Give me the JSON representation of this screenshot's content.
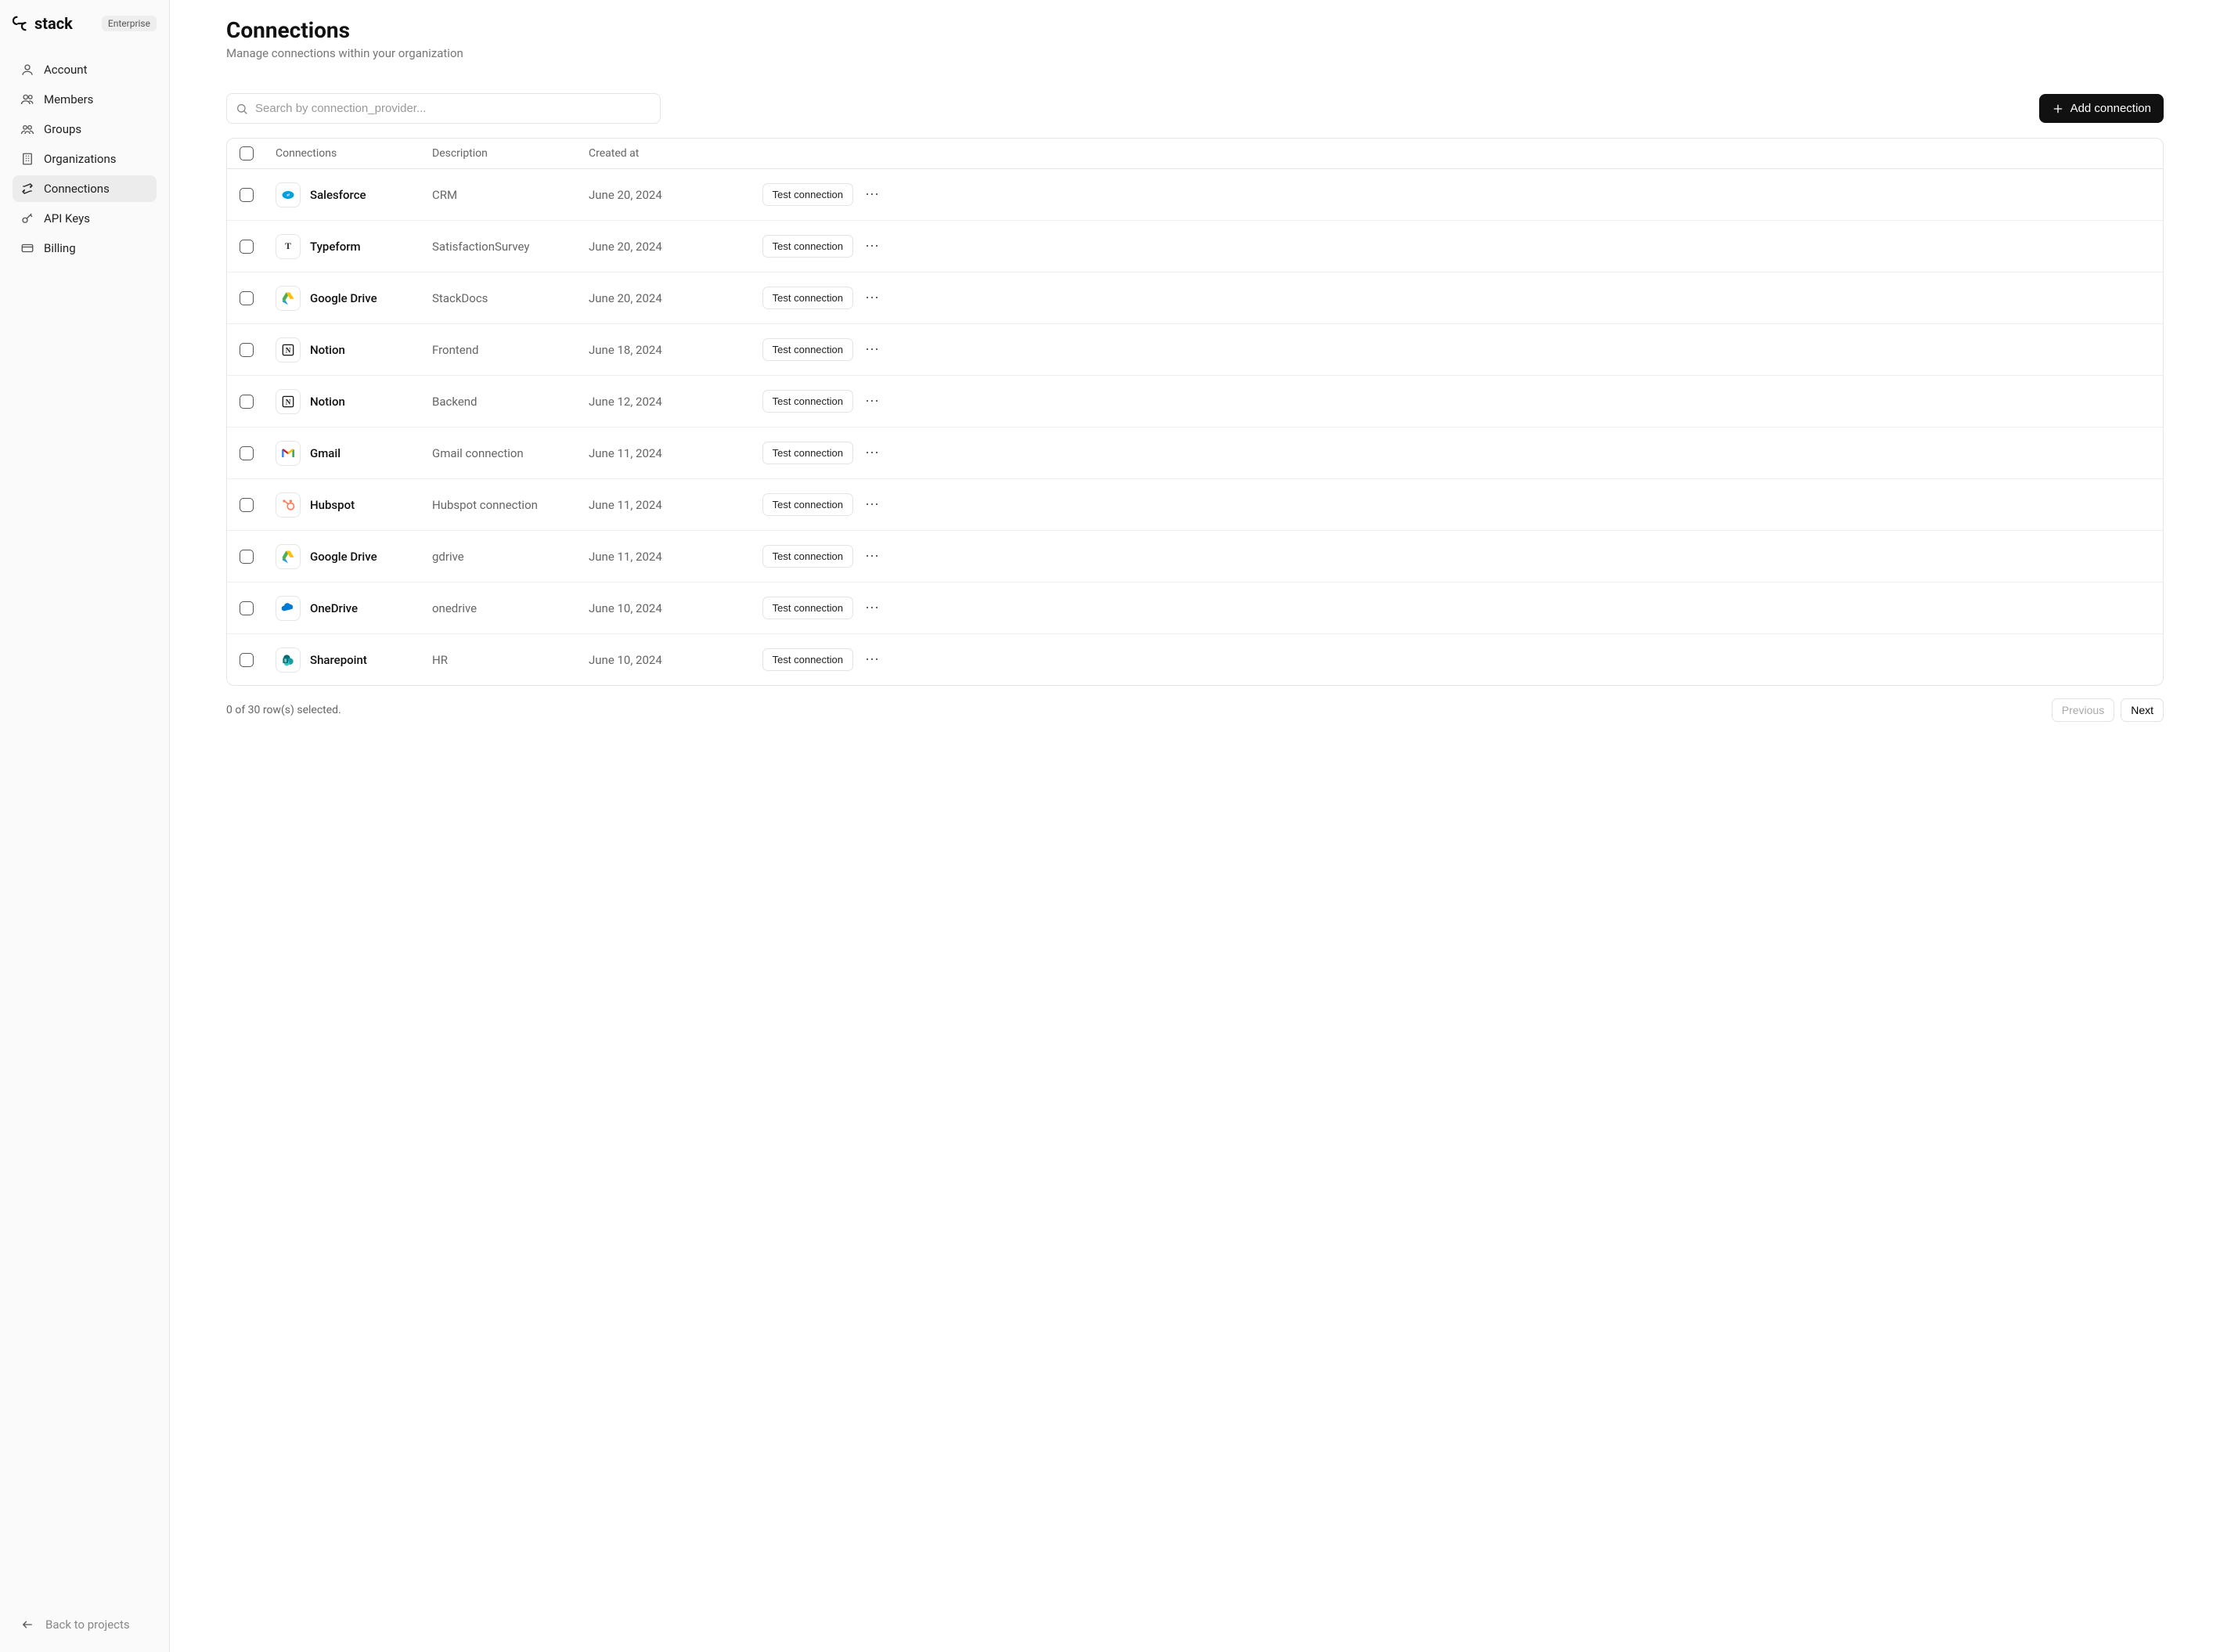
{
  "brand": {
    "name": "stack",
    "tier": "Enterprise"
  },
  "sidebar": {
    "items": [
      {
        "label": "Account",
        "icon": "user-icon"
      },
      {
        "label": "Members",
        "icon": "members-icon"
      },
      {
        "label": "Groups",
        "icon": "groups-icon"
      },
      {
        "label": "Organizations",
        "icon": "org-icon"
      },
      {
        "label": "Connections",
        "icon": "connections-icon",
        "active": true
      },
      {
        "label": "API Keys",
        "icon": "key-icon"
      },
      {
        "label": "Billing",
        "icon": "billing-icon"
      }
    ],
    "back_label": "Back to projects"
  },
  "page": {
    "title": "Connections",
    "subtitle": "Manage connections within your organization"
  },
  "toolbar": {
    "search_placeholder": "Search by connection_provider...",
    "add_label": "Add connection"
  },
  "table": {
    "headers": {
      "connections": "Connections",
      "description": "Description",
      "created_at": "Created at"
    },
    "rows": [
      {
        "icon": "salesforce",
        "name": "Salesforce",
        "description": "CRM",
        "created": "June 20, 2024"
      },
      {
        "icon": "typeform",
        "name": "Typeform",
        "description": "SatisfactionSurvey",
        "created": "June 20, 2024"
      },
      {
        "icon": "gdrive",
        "name": "Google Drive",
        "description": "StackDocs",
        "created": "June 20, 2024"
      },
      {
        "icon": "notion",
        "name": "Notion",
        "description": "Frontend",
        "created": "June 18, 2024"
      },
      {
        "icon": "notion",
        "name": "Notion",
        "description": "Backend",
        "created": "June 12, 2024"
      },
      {
        "icon": "gmail",
        "name": "Gmail",
        "description": "Gmail connection",
        "created": "June 11, 2024"
      },
      {
        "icon": "hubspot",
        "name": "Hubspot",
        "description": "Hubspot connection",
        "created": "June 11, 2024"
      },
      {
        "icon": "gdrive",
        "name": "Google Drive",
        "description": "gdrive",
        "created": "June 11, 2024"
      },
      {
        "icon": "onedrive",
        "name": "OneDrive",
        "description": "onedrive",
        "created": "June 10, 2024"
      },
      {
        "icon": "sharepoint",
        "name": "Sharepoint",
        "description": "HR",
        "created": "June 10, 2024"
      }
    ],
    "test_label": "Test connection"
  },
  "footer": {
    "selection": "0 of 30 row(s) selected.",
    "previous": "Previous",
    "next": "Next"
  }
}
